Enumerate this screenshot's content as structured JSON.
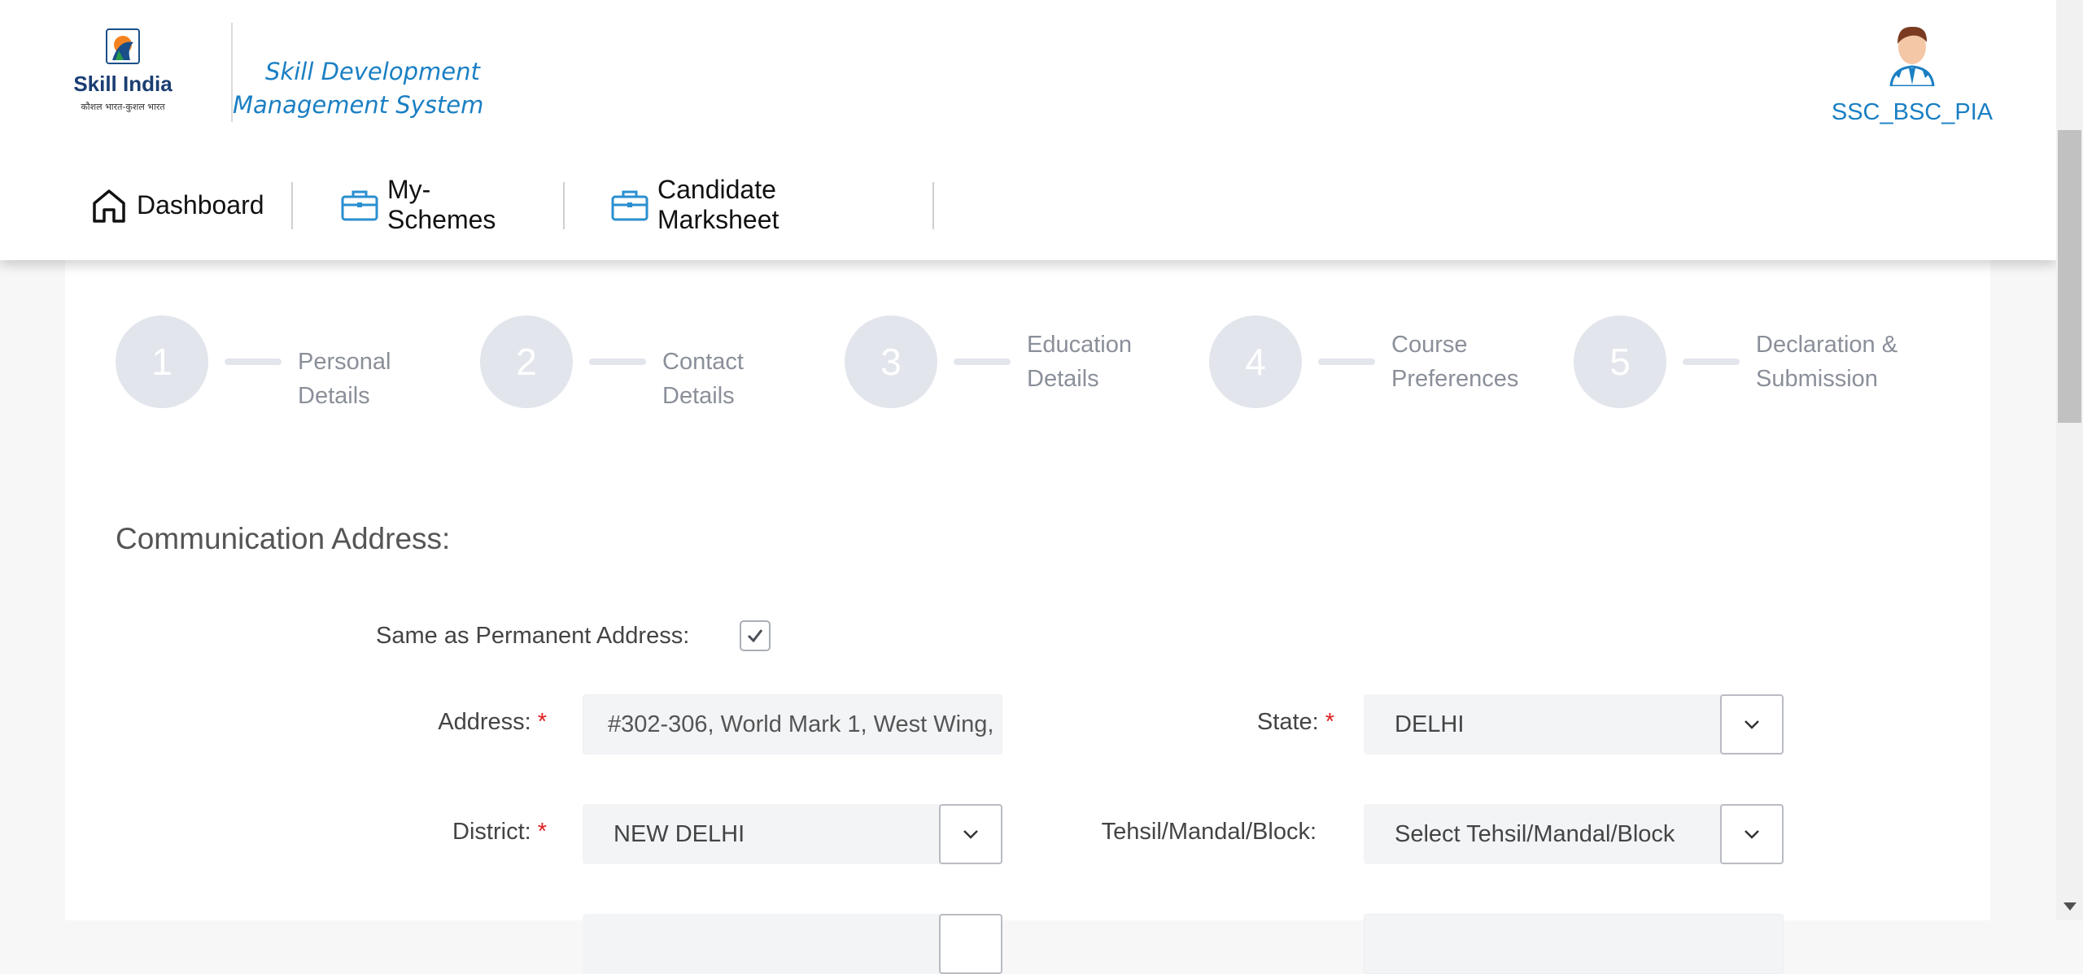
{
  "header": {
    "logo": {
      "name": "Skill India",
      "tagline": "कौशल भारत-कुशल भारत"
    },
    "app_title": "Skill Development Management System",
    "user_name": "SSC_BSC_PIA"
  },
  "nav": {
    "items": [
      {
        "label": "Dashboard",
        "icon": "home-icon"
      },
      {
        "label": "My-Schemes",
        "icon": "briefcase-icon"
      },
      {
        "label": "Candidate Marksheet",
        "icon": "briefcase-icon"
      }
    ]
  },
  "steps": [
    {
      "number": "1",
      "label": "Personal Details"
    },
    {
      "number": "2",
      "label": "Contact Details"
    },
    {
      "number": "3",
      "label": "Education Details"
    },
    {
      "number": "4",
      "label": "Course Preferences"
    },
    {
      "number": "5",
      "label": "Declaration & Submission"
    }
  ],
  "section": {
    "title": "Communication Address:",
    "same_as_permanent": {
      "label": "Same as Permanent Address:",
      "checked": true
    }
  },
  "fields": {
    "address": {
      "label": "Address:",
      "required_mark": "*",
      "value": "#302-306, World Mark 1, West Wing,"
    },
    "state": {
      "label": "State:",
      "required_mark": "*",
      "value": "DELHI"
    },
    "district": {
      "label": "District:",
      "required_mark": "*",
      "value": "NEW DELHI"
    },
    "tehsil": {
      "label": "Tehsil/Mandal/Block:",
      "value": "Select Tehsil/Mandal/Block"
    }
  },
  "colors": {
    "accent": "#1a7fc3",
    "step_inactive": "#e2e5ec",
    "required": "#e02020"
  }
}
